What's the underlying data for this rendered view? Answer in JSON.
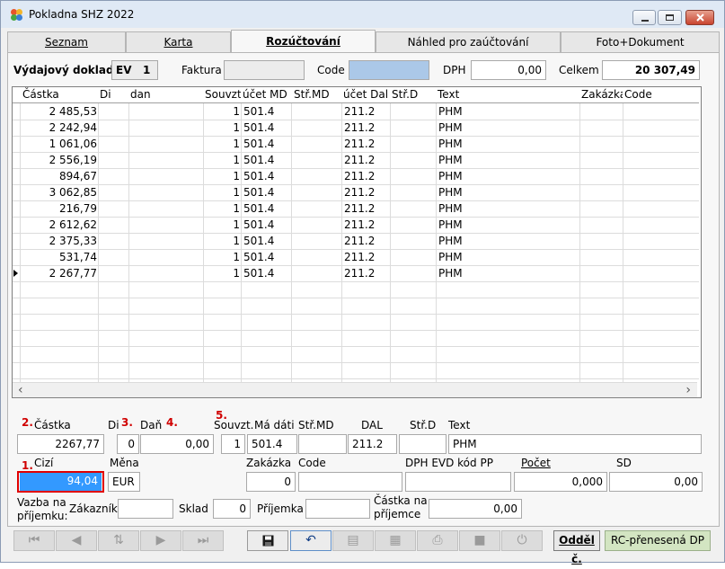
{
  "window": {
    "title": "Pokladna SHZ  2022"
  },
  "tabs": [
    {
      "label": "Seznam"
    },
    {
      "label": "Karta"
    },
    {
      "label": "Rozúčtování"
    },
    {
      "label": "Náhled pro zaúčtování"
    },
    {
      "label": "Foto+Dokument"
    }
  ],
  "header": {
    "doc_type": "Výdajový doklad",
    "doc_code": "EV",
    "doc_number": "1",
    "faktura_label": "Faktura",
    "faktura_value": "",
    "code_label": "Code",
    "code_value": "",
    "dph_label": "DPH",
    "dph_value": "0,00",
    "celkem_label": "Celkem",
    "celkem_value": "20 307,49"
  },
  "grid": {
    "columns": [
      "Částka",
      "Di",
      "dan",
      "Souvzt.",
      "účet MD",
      "Stř.MD",
      "účet Dal",
      "Stř.D",
      "Text",
      "Zakázka",
      "Code"
    ],
    "rows": [
      {
        "castka": "2 485,53",
        "souvzt": "1",
        "md": "501.4",
        "dal": "211.2",
        "text": "PHM"
      },
      {
        "castka": "2 242,94",
        "souvzt": "1",
        "md": "501.4",
        "dal": "211.2",
        "text": "PHM"
      },
      {
        "castka": "1 061,06",
        "souvzt": "1",
        "md": "501.4",
        "dal": "211.2",
        "text": "PHM"
      },
      {
        "castka": "2 556,19",
        "souvzt": "1",
        "md": "501.4",
        "dal": "211.2",
        "text": "PHM"
      },
      {
        "castka": "894,67",
        "souvzt": "1",
        "md": "501.4",
        "dal": "211.2",
        "text": "PHM"
      },
      {
        "castka": "3 062,85",
        "souvzt": "1",
        "md": "501.4",
        "dal": "211.2",
        "text": "PHM"
      },
      {
        "castka": "216,79",
        "souvzt": "1",
        "md": "501.4",
        "dal": "211.2",
        "text": "PHM"
      },
      {
        "castka": "2 612,62",
        "souvzt": "1",
        "md": "501.4",
        "dal": "211.2",
        "text": "PHM"
      },
      {
        "castka": "2 375,33",
        "souvzt": "1",
        "md": "501.4",
        "dal": "211.2",
        "text": "PHM"
      },
      {
        "castka": "531,74",
        "souvzt": "1",
        "md": "501.4",
        "dal": "211.2",
        "text": "PHM"
      },
      {
        "castka": "2 267,77",
        "souvzt": "1",
        "md": "501.4",
        "dal": "211.2",
        "text": "PHM"
      }
    ]
  },
  "detail": {
    "markers": {
      "m1": "1.",
      "m2": "2.",
      "m3": "3.",
      "m4": "4.",
      "m5": "5."
    },
    "castka_label": "Částka",
    "castka_value": "2267,77",
    "di_label": "Di",
    "di_value": "0",
    "dan_label": "Daň",
    "dan_value": "0,00",
    "souvzt_label": "Souvzt.",
    "souvzt_value": "1",
    "madati_label": "Má dáti",
    "madati_value": "501.4",
    "strmd_label": "Stř.MD",
    "strmd_value": "",
    "dal_label": "DAL",
    "dal_value": "211.2",
    "strd_label": "Stř.D",
    "strd_value": "",
    "text_label": "Text",
    "text_value": "PHM",
    "cizi_label": "Cizí",
    "cizi_value": "94,04",
    "mena_label": "Měna",
    "mena_value": "EUR",
    "zakazka_label": "Zakázka",
    "zakazka_value": "0",
    "code_label": "Code",
    "code_value": "",
    "dphevd_label": "DPH EVD kód PP",
    "dphevd_value": "",
    "pocet_label": "Počet",
    "pocet_value": "0,000",
    "sd_label": "SD",
    "sd_value": "0,00",
    "vazba_label_1": "Vazba na",
    "vazba_label_2": "příjemku:",
    "zakaznik_label": "Zákazník",
    "zakaznik_value": "",
    "sklad_label": "Sklad",
    "sklad_value": "0",
    "prijemka_label": "Příjemka",
    "prijemka_value": "",
    "castka_prij_label_1": "Částka na",
    "castka_prij_label_2": "příjemce",
    "castka_prij_value": "0,00"
  },
  "footer": {
    "oddel_label": "Odděl č.",
    "rc_label": "RC-přenesená DP"
  },
  "icons": {
    "first": "first-record-icon",
    "prev": "prev-record-icon",
    "sort": "sort-icon",
    "next": "next-record-icon",
    "last": "last-record-icon",
    "save": "save-icon",
    "undo": "undo-icon",
    "colors": {
      "accent": "#ff0000",
      "selected": "#3399ff",
      "rc": "#d3e5c2"
    }
  }
}
